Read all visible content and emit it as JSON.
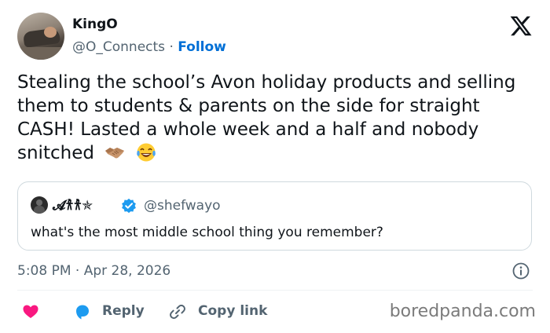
{
  "author": {
    "display_name": "KingO",
    "handle": "@O_Connects",
    "separator": "·",
    "follow_label": "Follow"
  },
  "tweet": {
    "text": "Stealing the school’s Avon holiday products and selling them to students & parents on the side for straight CASH! Lasted a whole week and a half and nobody snitched",
    "emojis": [
      "handshake-emoji",
      "laughing-tears-emoji"
    ],
    "timestamp": "5:08 PM · Apr 28, 2026"
  },
  "quoted": {
    "display_name": "𝓐𐀪𐀪✯",
    "handle": "@shefwayo",
    "text": "what's the most middle school thing you remember?"
  },
  "actions": {
    "like_icon": "heart-icon",
    "reply_label": "Reply",
    "copy_label": "Copy link"
  },
  "watermark": "boredpanda.com",
  "colors": {
    "accent": "#1d9bf0",
    "follow": "#006fd6",
    "like": "#f91880",
    "secondary_text": "#536471"
  }
}
